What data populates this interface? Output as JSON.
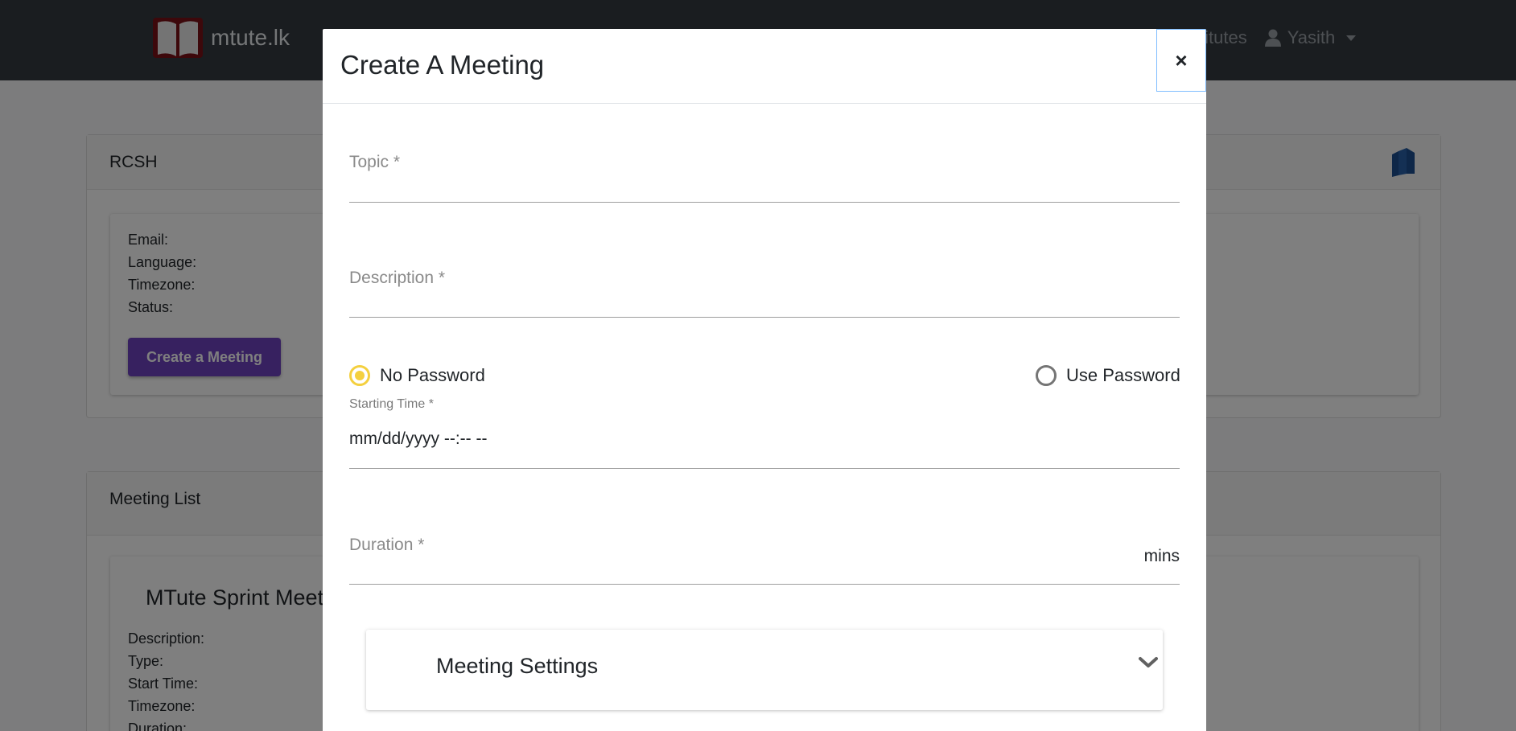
{
  "navbar": {
    "brand": "mtute.lk",
    "links": [
      "stitutes"
    ],
    "user": "Yasith"
  },
  "account_card": {
    "title": "RCSH",
    "fields": [
      "Email:",
      "Language:",
      "Timezone:",
      "Status:"
    ],
    "create_button": "Create a Meeting"
  },
  "meeting_list": {
    "title": "Meeting List",
    "item_title": "MTute Sprint Meet",
    "fields": [
      "Description:",
      "Type:",
      "Start Time:",
      "Timezone:",
      "Duration:"
    ]
  },
  "modal": {
    "title": "Create A Meeting",
    "close": "×",
    "topic_label": "Topic *",
    "description_label": "Description *",
    "password_options": [
      "No Password",
      "Use Password"
    ],
    "password_selected": "No Password",
    "starting_time_label": "Starting Time *",
    "starting_time_placeholder": "mm/dd/yyyy --:-- --",
    "duration_label": "Duration *",
    "duration_unit": "mins",
    "settings_title": "Meeting Settings"
  },
  "colors": {
    "navbar": "#343a40",
    "accent_purple": "#6f42c1",
    "radio_selected": "#f4d03f"
  }
}
